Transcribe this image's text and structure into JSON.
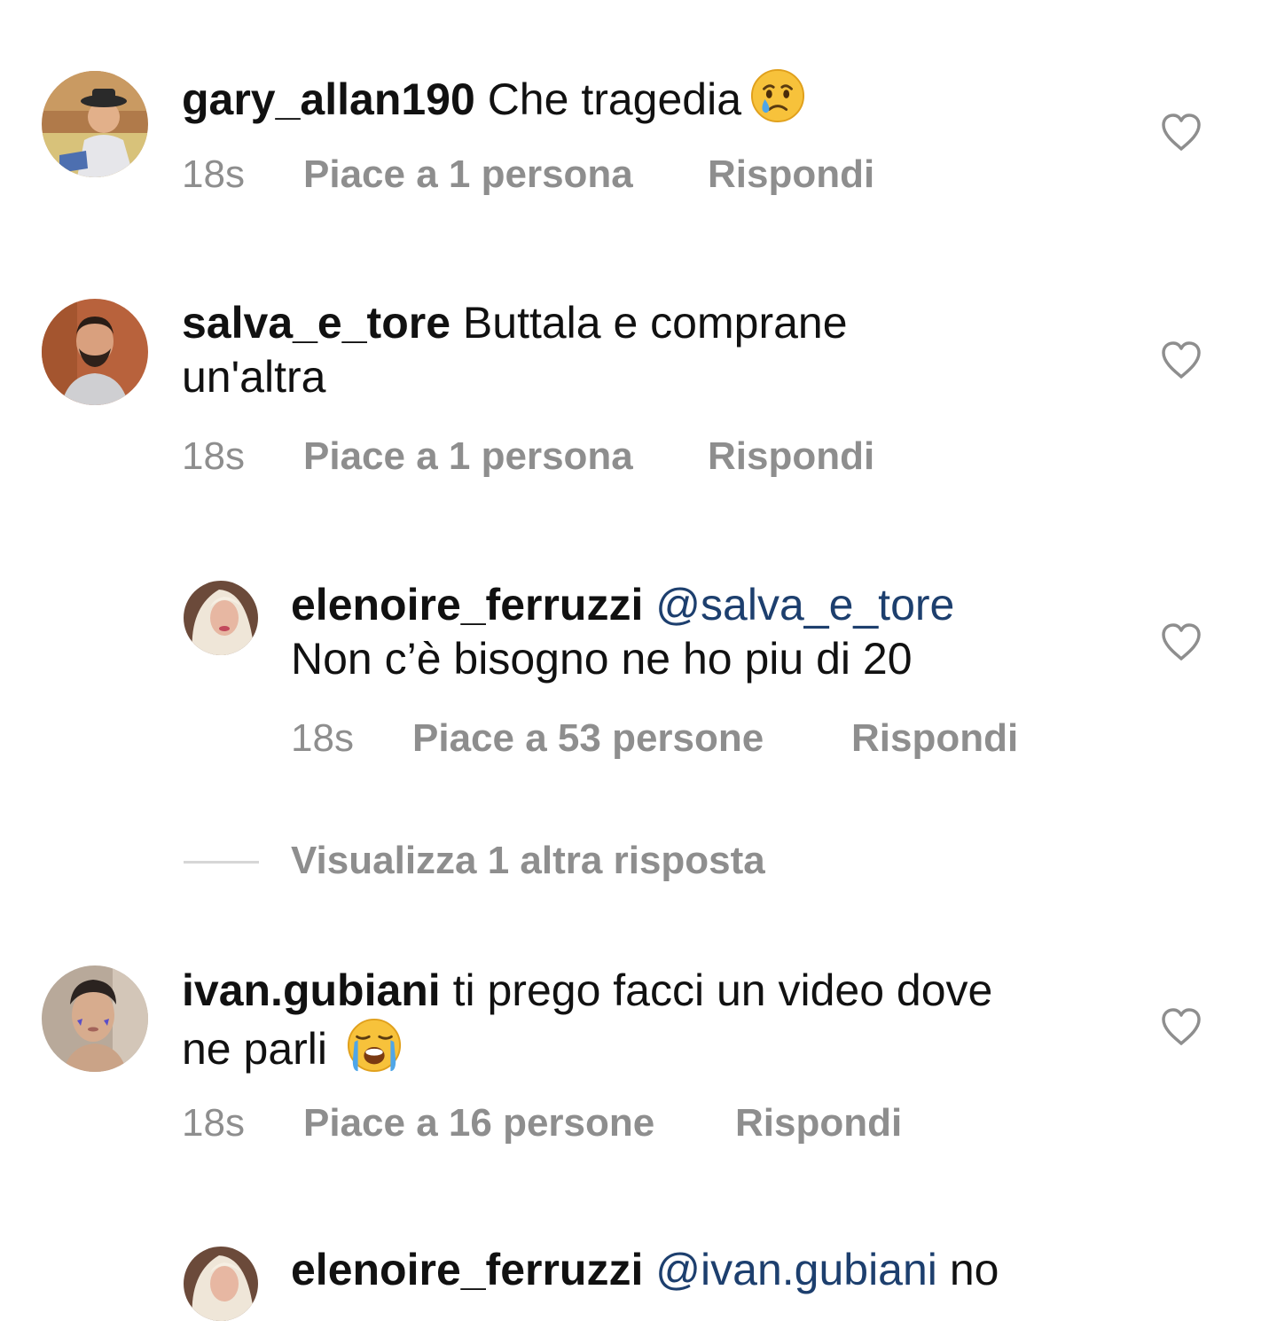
{
  "comments": [
    {
      "username": "gary_allan190",
      "text": "Che tragedia",
      "emoji": "crying-face",
      "time": "18s",
      "likes": "Piace a 1 persona",
      "reply": "Rispondi"
    },
    {
      "username": "salva_e_tore",
      "text_line1": "Buttala e comprane",
      "text_line2": "un'altra",
      "time": "18s",
      "likes": "Piace a 1 persona",
      "reply": "Rispondi"
    },
    {
      "username": "elenoire_ferruzzi",
      "mention": "@salva_e_tore",
      "text": "Non c’è bisogno ne ho piu di 20",
      "time": "18s",
      "likes": "Piace a 53 persone",
      "reply": "Rispondi"
    },
    {
      "username": "ivan.gubiani",
      "text_line1": "ti prego facci un video dove",
      "text_line2": "ne parli",
      "emoji": "loudly-crying-face",
      "time": "18s",
      "likes": "Piace a 16 persone",
      "reply": "Rispondi"
    },
    {
      "username": "elenoire_ferruzzi",
      "mention": "@ivan.gubiani",
      "text": "no"
    }
  ],
  "view_replies": "Visualizza 1 altra risposta",
  "icons": {
    "like": "heart-outline-icon",
    "emoji_1": "crying-face",
    "emoji_2": "loudly-crying-face"
  },
  "colors": {
    "text": "#111111",
    "meta": "#8e8e8e",
    "mention": "#1d3f6e",
    "divider": "#d6d6d6"
  }
}
